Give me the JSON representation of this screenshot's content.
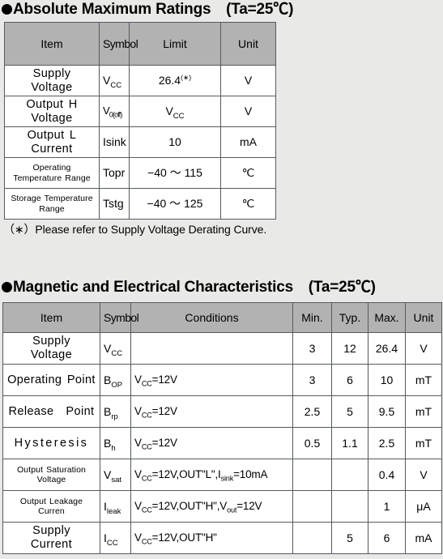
{
  "sections": {
    "abs_max": {
      "heading": "Absolute Maximum Ratings　(Ta=25℃)",
      "footnote": "（∗）Please refer to Supply Voltage Derating Curve.",
      "columns": {
        "item": "Item",
        "symbol": "Symbol",
        "limit": "Limit",
        "unit": "Unit"
      },
      "rows": [
        {
          "item": "Supply　Voltage",
          "symbol_base": "V",
          "symbol_sub": "CC",
          "limit_base": "26.4",
          "limit_sup": "(∗)",
          "limit_sub": "",
          "unit": "V"
        },
        {
          "item": "Output H Voltage",
          "symbol_base": "V",
          "symbol_sub": "0(off)",
          "limit_base": "V",
          "limit_sup": "",
          "limit_sub": "CC",
          "unit": "V"
        },
        {
          "item": "Output L Current",
          "symbol_base": "Isink",
          "symbol_sub": "",
          "limit_base": "10",
          "limit_sup": "",
          "limit_sub": "",
          "unit": "mA"
        },
        {
          "item": "Operating Temperature Range",
          "symbol_base": "Topr",
          "symbol_sub": "",
          "limit_base": "−40 ～ 115",
          "limit_sup": "",
          "limit_sub": "",
          "unit": "℃"
        },
        {
          "item": "Storage Temperature Range",
          "symbol_base": "Tstg",
          "symbol_sub": "",
          "limit_base": "−40 ～ 125",
          "limit_sup": "",
          "limit_sub": "",
          "unit": "℃"
        }
      ]
    },
    "mag_elec": {
      "heading": "Magnetic and Electrical Characteristics　(Ta=25℃)",
      "columns": {
        "item": "Item",
        "symbol": "Symbol",
        "conditions": "Conditions",
        "min": "Min.",
        "typ": "Typ.",
        "max": "Max.",
        "unit": "Unit"
      },
      "rows": [
        {
          "item": "Supply　Voltage",
          "symbol_base": "V",
          "symbol_sub": "CC",
          "conditions": "",
          "min": "3",
          "typ": "12",
          "max": "26.4",
          "unit": "V"
        },
        {
          "item": "Operating Point",
          "symbol_base": "B",
          "symbol_sub": "OP",
          "conditions": "VCC=12V",
          "min": "3",
          "typ": "6",
          "max": "10",
          "unit": "mT"
        },
        {
          "item": "Release　Point",
          "symbol_base": "B",
          "symbol_sub": "rp",
          "conditions": "VCC=12V",
          "min": "2.5",
          "typ": "5",
          "max": "9.5",
          "unit": "mT"
        },
        {
          "item": "Hysteresis",
          "symbol_base": "B",
          "symbol_sub": "h",
          "conditions": "VCC=12V",
          "min": "0.5",
          "typ": "1.1",
          "max": "2.5",
          "unit": "mT"
        },
        {
          "item": "Output  Saturation  Voltage",
          "symbol_base": "V",
          "symbol_sub": "sat",
          "conditions": "VCC=12V,OUT\"L\",Isink=10mA",
          "min": "",
          "typ": "",
          "max": "0.4",
          "unit": "V"
        },
        {
          "item": "Output Leakage Curren",
          "symbol_base": "I",
          "symbol_sub": "leak",
          "conditions": "VCC=12V,OUT\"H\",Vout=12V",
          "min": "",
          "typ": "",
          "max": "1",
          "unit": "μA"
        },
        {
          "item": "Supply　Current",
          "symbol_base": "I",
          "symbol_sub": "CC",
          "conditions": "VCC=12V,OUT\"H\"",
          "min": "",
          "typ": "5",
          "max": "6",
          "unit": "mA"
        }
      ]
    }
  },
  "colors": {
    "page_background": "#e9e9e7",
    "header_fill": "#b2b2b2",
    "cell_fill": "#ffffff",
    "border": "#555a5e",
    "text": "#000000"
  }
}
